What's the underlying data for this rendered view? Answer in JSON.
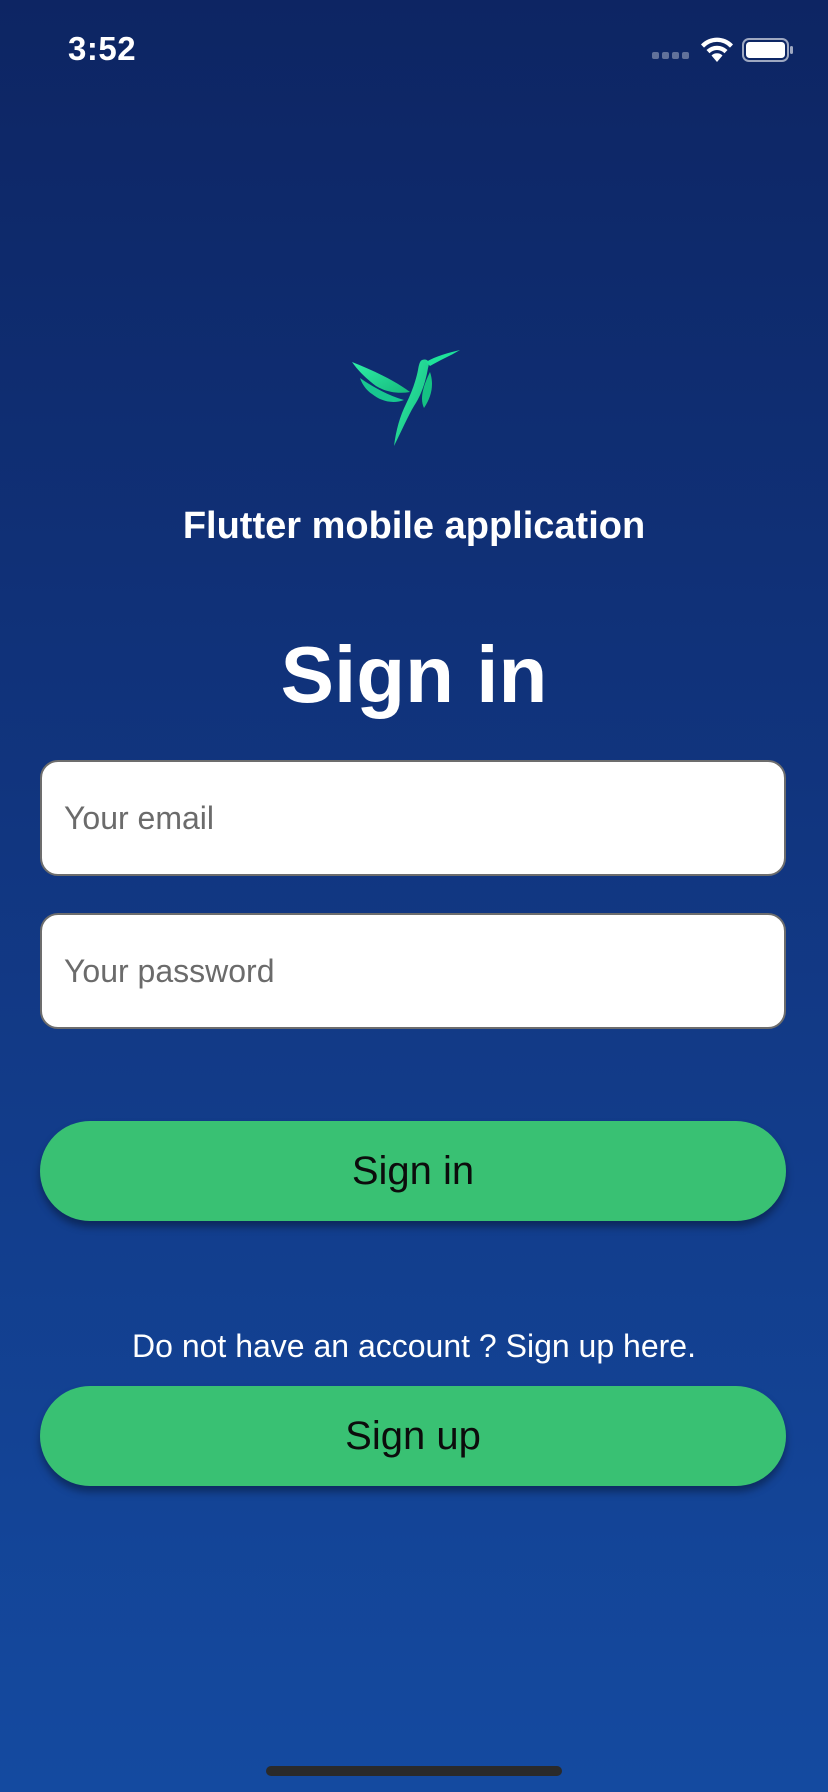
{
  "status_bar": {
    "time": "3:52",
    "icons": [
      "signal-icon",
      "wifi-icon",
      "battery-icon"
    ]
  },
  "logo": {
    "icon": "hummingbird-logo-icon",
    "colors": [
      "#1ee39a",
      "#16b97c"
    ]
  },
  "header": {
    "app_title": "Flutter mobile application",
    "page_title": "Sign in"
  },
  "form": {
    "email": {
      "value": "",
      "placeholder": "Your email"
    },
    "password": {
      "value": "",
      "placeholder": "Your password"
    },
    "signin_label": "Sign in"
  },
  "signup": {
    "prompt": "Do not have an account ? Sign up here.",
    "button_label": "Sign up"
  },
  "colors": {
    "background_top": "#0d2563",
    "background_bottom": "#144aa0",
    "accent": "#39c173",
    "text": "#ffffff"
  }
}
